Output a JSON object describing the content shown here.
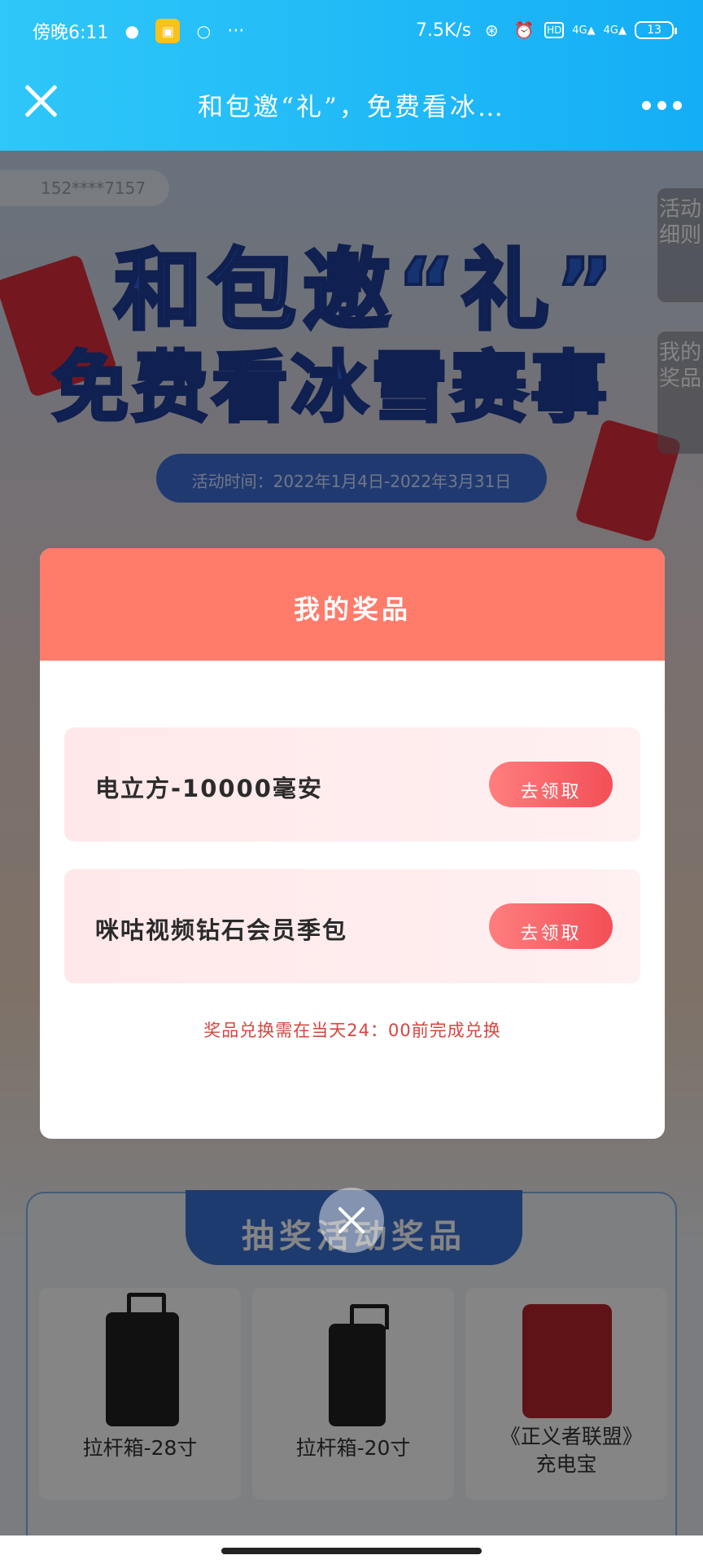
{
  "status_bar": {
    "time": "傍晚6:11",
    "more": "···",
    "network_speed": "7.5K/s",
    "network_label": "4G",
    "battery": "13",
    "icons": [
      "wechat-icon",
      "app-icon",
      "message-icon",
      "bluetooth-icon",
      "alarm-icon",
      "hd-icon",
      "signal-icon",
      "signal-icon",
      "battery-icon"
    ]
  },
  "titlebar": {
    "title": "和包邀“礼”，免费看冰…",
    "close_icon": "close-icon",
    "more_icon": "more-icon"
  },
  "page": {
    "phone": "152****7157",
    "hero_line1": "和包邀“礼”",
    "hero_line2": "免费看冰雪赛事",
    "activity_time": "活动时间：2022年1月4日-2022年3月31日",
    "side_tabs": [
      "活动细则",
      "我的奖品"
    ],
    "prizes_section_title": "抽奖活动奖品",
    "prizes": [
      {
        "label": "拉杆箱-28寸"
      },
      {
        "label": "拉杆箱-20寸"
      },
      {
        "label": "《正义者联盟》充电宝"
      }
    ]
  },
  "modal": {
    "title": "我的奖品",
    "items": [
      {
        "name": "电立方-10000毫安",
        "button": "去领取"
      },
      {
        "name": "咪咕视频钻石会员季包",
        "button": "去领取"
      }
    ],
    "notice": "奖品兑换需在当天24：00前完成兑换"
  },
  "colors": {
    "topbar": "#14aef6",
    "modal_header": "#ff7b6a",
    "claim_button": "#f34f57",
    "notice": "#d5463f"
  }
}
